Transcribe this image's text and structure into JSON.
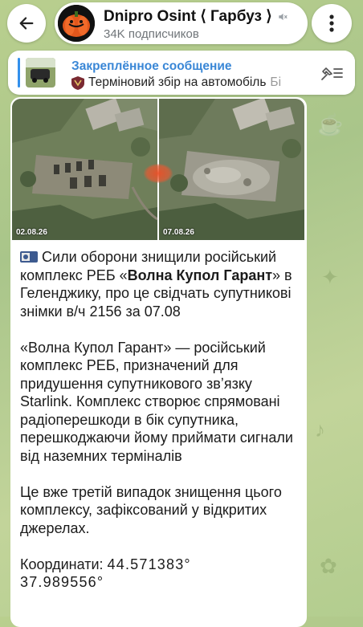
{
  "header": {
    "channel_title": "Dnipro Osint ⟨ Гарбуз ⟩",
    "subscribers": "34K подписчиков",
    "icons": [
      "back-arrow-icon",
      "muted-speaker-icon",
      "more-vert-icon"
    ]
  },
  "pinned": {
    "label": "Закреплённое сообщение",
    "text": "Терміновий збір на автомобіль",
    "text_cut": "Бі",
    "icon": "pin-list-icon"
  },
  "message": {
    "photos": [
      {
        "date": "02.08.26"
      },
      {
        "date": "07.08.26"
      }
    ],
    "line1_prefix": "Сили оборони знищили російський комплекс РЕБ «",
    "line1_bold": "Волна Купол Гарант",
    "line1_suffix": "» в Геленджику, про це свідчать супутникові знімки в/ч 2156 за 07.08",
    "paragraph2": "«Волна Купол Гарант» — російський комплекс РЕБ, призначений для придушення супутникового звʼязку Starlink. Комплекс створює спрямовані радіоперешкоди в бік супутника, перешкоджаючи йому приймати сигнали від наземних терміналів",
    "paragraph3": "Це вже третій випадок знищення цього комплексу, зафіксований у відкритих джерелах.",
    "coords_label": "Координати:",
    "coords_lat": "44.571383°",
    "coords_lon": "37.989556°"
  },
  "colors": {
    "accent": "#3390ec",
    "bubble": "#ffffff",
    "background": "#b9cf8e"
  }
}
